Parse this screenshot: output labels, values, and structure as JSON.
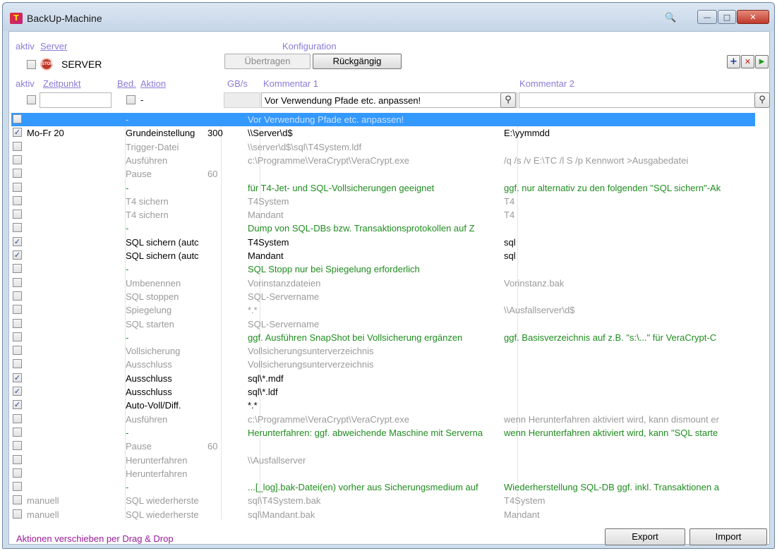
{
  "window": {
    "title": "BackUp-Machine",
    "controls": {
      "minimize": "—",
      "maximize": "□",
      "close": "✕"
    }
  },
  "icons": {
    "app": "T",
    "binoculars": "binoculars-icon",
    "stop": "STOP",
    "search": "⚲",
    "add": "+",
    "delete": "✕",
    "run": "▶"
  },
  "colors": {
    "header": "#8a7bd6",
    "green": "#1f8c1f",
    "grey": "#9a9a9a",
    "selection": "#3399ff",
    "footer": "#9a1a9a"
  },
  "server_section": {
    "header_aktiv": "aktiv",
    "header_server": "Server",
    "header_konfiguration": "Konfiguration",
    "server_name": "SERVER",
    "uebertragen": "Übertragen",
    "rueckgaengig": "Rückgängig"
  },
  "columns": {
    "aktiv": "aktiv",
    "zeitpunkt": "Zeitpunkt",
    "bed": "Bed.",
    "aktion": "Aktion",
    "gbs": "GB/s",
    "kommentar1": "Kommentar 1",
    "kommentar2": "Kommentar 2"
  },
  "filter": {
    "aktion": "-",
    "kommentar1": "Vor Verwendung Pfade etc. anpassen!",
    "kommentar2": ""
  },
  "rows": [
    {
      "checked": false,
      "zeit": "",
      "aktion": "-",
      "gb": "",
      "k1": "Vor Verwendung Pfade etc. anpassen!",
      "k2": "",
      "style": "s",
      "selected": true
    },
    {
      "checked": true,
      "zeit": "Mo-Fr 20",
      "aktion": "Grundeinstellung",
      "gb": "300",
      "k1": "\\\\Server\\d$",
      "k2": "E:\\yymmdd",
      "style": "n"
    },
    {
      "checked": false,
      "zeit": "",
      "aktion": "Trigger-Datei",
      "gb": "",
      "k1": "\\\\server\\d$\\sql\\T4System.ldf",
      "k2": "",
      "style": "g"
    },
    {
      "checked": false,
      "zeit": "",
      "aktion": "Ausführen",
      "gb": "",
      "k1": "c:\\Programme\\VeraCrypt\\VeraCrypt.exe",
      "k2": "/q /s /v E:\\TC /l S /p Kennwort >Ausgabedatei",
      "style": "g"
    },
    {
      "checked": false,
      "zeit": "",
      "aktion": "Pause",
      "gb": "60",
      "k1": "",
      "k2": "",
      "style": "g"
    },
    {
      "checked": false,
      "zeit": "",
      "aktion": "-",
      "gb": "",
      "k1": "für T4-Jet- und SQL-Vollsicherungen geeignet",
      "k2": "ggf. nur alternativ zu den folgenden \"SQL sichern\"-Ak",
      "style": "gr"
    },
    {
      "checked": false,
      "zeit": "",
      "aktion": "T4 sichern",
      "gb": "",
      "k1": "T4System",
      "k2": "T4",
      "style": "g"
    },
    {
      "checked": false,
      "zeit": "",
      "aktion": "T4 sichern",
      "gb": "",
      "k1": "Mandant",
      "k2": "T4",
      "style": "g"
    },
    {
      "checked": false,
      "zeit": "",
      "aktion": "-",
      "gb": "",
      "k1": "Dump von SQL-DBs bzw. Transaktionsprotokollen auf Z",
      "k2": "",
      "style": "gr"
    },
    {
      "checked": true,
      "zeit": "",
      "aktion": "SQL sichern (autc",
      "gb": "",
      "k1": "T4System",
      "k2": "sql",
      "style": "n"
    },
    {
      "checked": true,
      "zeit": "",
      "aktion": "SQL sichern (autc",
      "gb": "",
      "k1": "Mandant",
      "k2": "sql",
      "style": "n"
    },
    {
      "checked": false,
      "zeit": "",
      "aktion": "-",
      "gb": "",
      "k1": "SQL Stopp nur bei Spiegelung erforderlich",
      "k2": "",
      "style": "gr"
    },
    {
      "checked": false,
      "zeit": "",
      "aktion": "Umbenennen",
      "gb": "",
      "k1": "Vorinstanzdateien",
      "k2": "Vorinstanz.bak",
      "style": "g"
    },
    {
      "checked": false,
      "zeit": "",
      "aktion": "SQL stoppen",
      "gb": "",
      "k1": "SQL-Servername",
      "k2": "",
      "style": "g"
    },
    {
      "checked": false,
      "zeit": "",
      "aktion": "Spiegelung",
      "gb": "",
      "k1": "*.*",
      "k2": "\\\\Ausfallserver\\d$",
      "style": "g"
    },
    {
      "checked": false,
      "zeit": "",
      "aktion": "SQL starten",
      "gb": "",
      "k1": "SQL-Servername",
      "k2": "",
      "style": "g"
    },
    {
      "checked": false,
      "zeit": "",
      "aktion": "-",
      "gb": "",
      "k1": "ggf. Ausführen SnapShot bei Vollsicherung ergänzen",
      "k2": "ggf. Basisverzeichnis auf z.B. \"s:\\...\" für VeraCrypt-C",
      "style": "gr"
    },
    {
      "checked": false,
      "zeit": "",
      "aktion": "Vollsicherung",
      "gb": "",
      "k1": "Vollsicherungsunterverzeichnis",
      "k2": "",
      "style": "g"
    },
    {
      "checked": false,
      "zeit": "",
      "aktion": "Ausschluss",
      "gb": "",
      "k1": "Vollsicherungsunterverzeichnis",
      "k2": "",
      "style": "g"
    },
    {
      "checked": true,
      "zeit": "",
      "aktion": "Ausschluss",
      "gb": "",
      "k1": "sql\\*.mdf",
      "k2": "",
      "style": "n"
    },
    {
      "checked": true,
      "zeit": "",
      "aktion": "Ausschluss",
      "gb": "",
      "k1": "sql\\*.ldf",
      "k2": "",
      "style": "n"
    },
    {
      "checked": true,
      "zeit": "",
      "aktion": "Auto-Voll/Diff.",
      "gb": "",
      "k1": "*.*",
      "k2": "",
      "style": "n"
    },
    {
      "checked": false,
      "zeit": "",
      "aktion": "Ausführen",
      "gb": "",
      "k1": "c:\\Programme\\VeraCrypt\\VeraCrypt.exe",
      "k2": "wenn Herunterfahren aktiviert wird, kann dismount er",
      "style": "g"
    },
    {
      "checked": false,
      "zeit": "",
      "aktion": "-",
      "gb": "",
      "k1": "Herunterfahren: ggf. abweichende Maschine mit Serverna",
      "k2": "wenn Herunterfahren aktiviert wird, kann \"SQL starte",
      "style": "gr"
    },
    {
      "checked": false,
      "zeit": "",
      "aktion": "Pause",
      "gb": "60",
      "k1": "",
      "k2": "",
      "style": "g"
    },
    {
      "checked": false,
      "zeit": "",
      "aktion": "Herunterfahren",
      "gb": "",
      "k1": "\\\\Ausfallserver",
      "k2": "",
      "style": "g"
    },
    {
      "checked": false,
      "zeit": "",
      "aktion": "Herunterfahren",
      "gb": "",
      "k1": "",
      "k2": "",
      "style": "g"
    },
    {
      "checked": false,
      "zeit": "",
      "aktion": "-",
      "gb": "",
      "k1": "...[_log].bak-Datei(en) vorher aus Sicherungsmedium auf",
      "k2": "Wiederherstellung SQL-DB ggf. inkl. Transaktionen a",
      "style": "gr"
    },
    {
      "checked": false,
      "zeit": "manuell",
      "aktion": "SQL wiederherste",
      "gb": "",
      "k1": "sql\\T4System.bak",
      "k2": "T4System",
      "style": "g"
    },
    {
      "checked": false,
      "zeit": "manuell",
      "aktion": "SQL wiederherste",
      "gb": "",
      "k1": "sql\\Mandant.bak",
      "k2": "Mandant",
      "style": "g"
    }
  ],
  "footer": {
    "hint": "Aktionen verschieben per Drag & Drop",
    "export": "Export",
    "import": "Import"
  }
}
